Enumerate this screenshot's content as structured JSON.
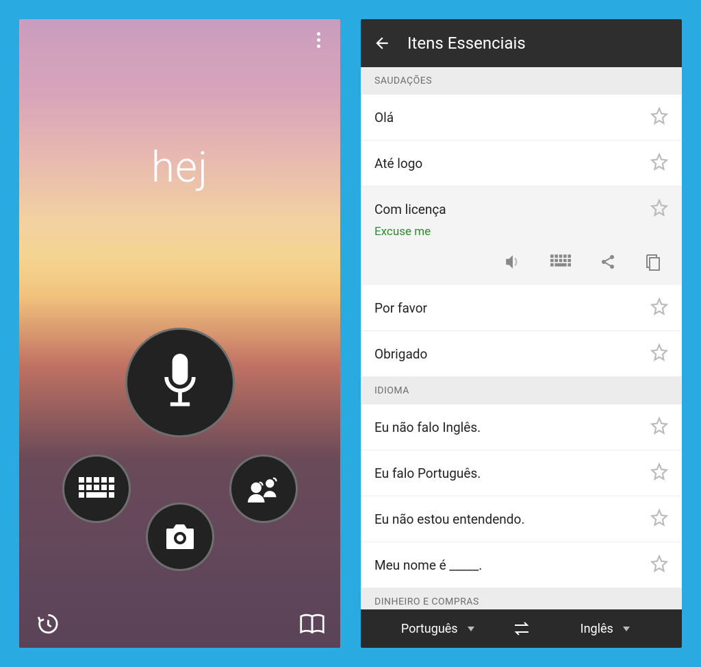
{
  "left": {
    "word": "hej"
  },
  "right": {
    "header_title": "Itens Essenciais",
    "sections": {
      "greetings": {
        "header": "SAUDAÇÕES",
        "items": [
          "Olá",
          "Até logo",
          "Com licença",
          "Por favor",
          "Obrigado"
        ],
        "selected_translation": "Excuse me"
      },
      "language": {
        "header": "IDIOMA",
        "items": [
          "Eu não falo Inglês.",
          "Eu falo Português.",
          "Eu não estou entendendo.",
          "Meu nome é _____."
        ]
      },
      "money": {
        "header": "DINHEIRO E COMPRAS"
      }
    },
    "footer": {
      "lang_from": "Português",
      "lang_to": "Inglês"
    }
  }
}
